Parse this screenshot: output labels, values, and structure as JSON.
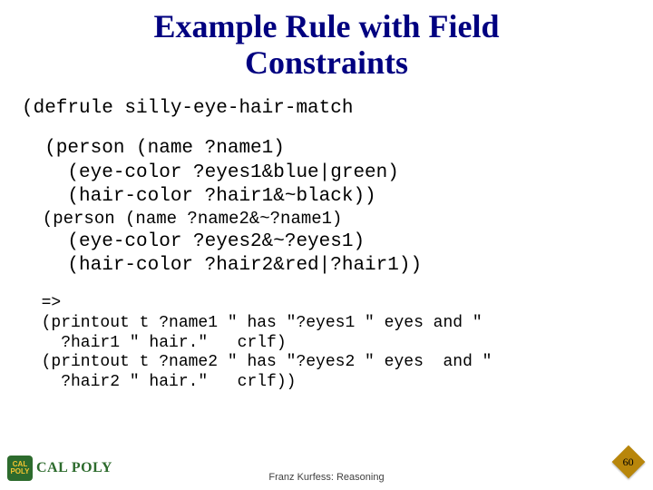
{
  "title_line1": "Example Rule with Field",
  "title_line2": "Constraints",
  "code": {
    "defrule": "(defrule silly-eye-hair-match",
    "p1_l1": "  (person (name ?name1)",
    "p1_l2": "    (eye-color ?eyes1&blue|green)",
    "p1_l3": "    (hair-color ?hair1&~black))",
    "p2_l1": "  (person (name ?name2&~?name1)",
    "p2_l2": "    (eye-color ?eyes2&~?eyes1)",
    "p2_l3": "    (hair-color ?hair2&red|?hair1))",
    "arrow": "  =>",
    "out1a": "  (printout t ?name1 \" has \"?eyes1 \" eyes and \"",
    "out1b": "    ?hair1 \" hair.\"   crlf)",
    "out2a": "  (printout t ?name2 \" has \"?eyes2 \" eyes  and \"",
    "out2b": "    ?hair2 \" hair.\"   crlf))"
  },
  "logo_text": "CAL POLY",
  "footer": "Franz Kurfess: Reasoning",
  "page_num": "60"
}
